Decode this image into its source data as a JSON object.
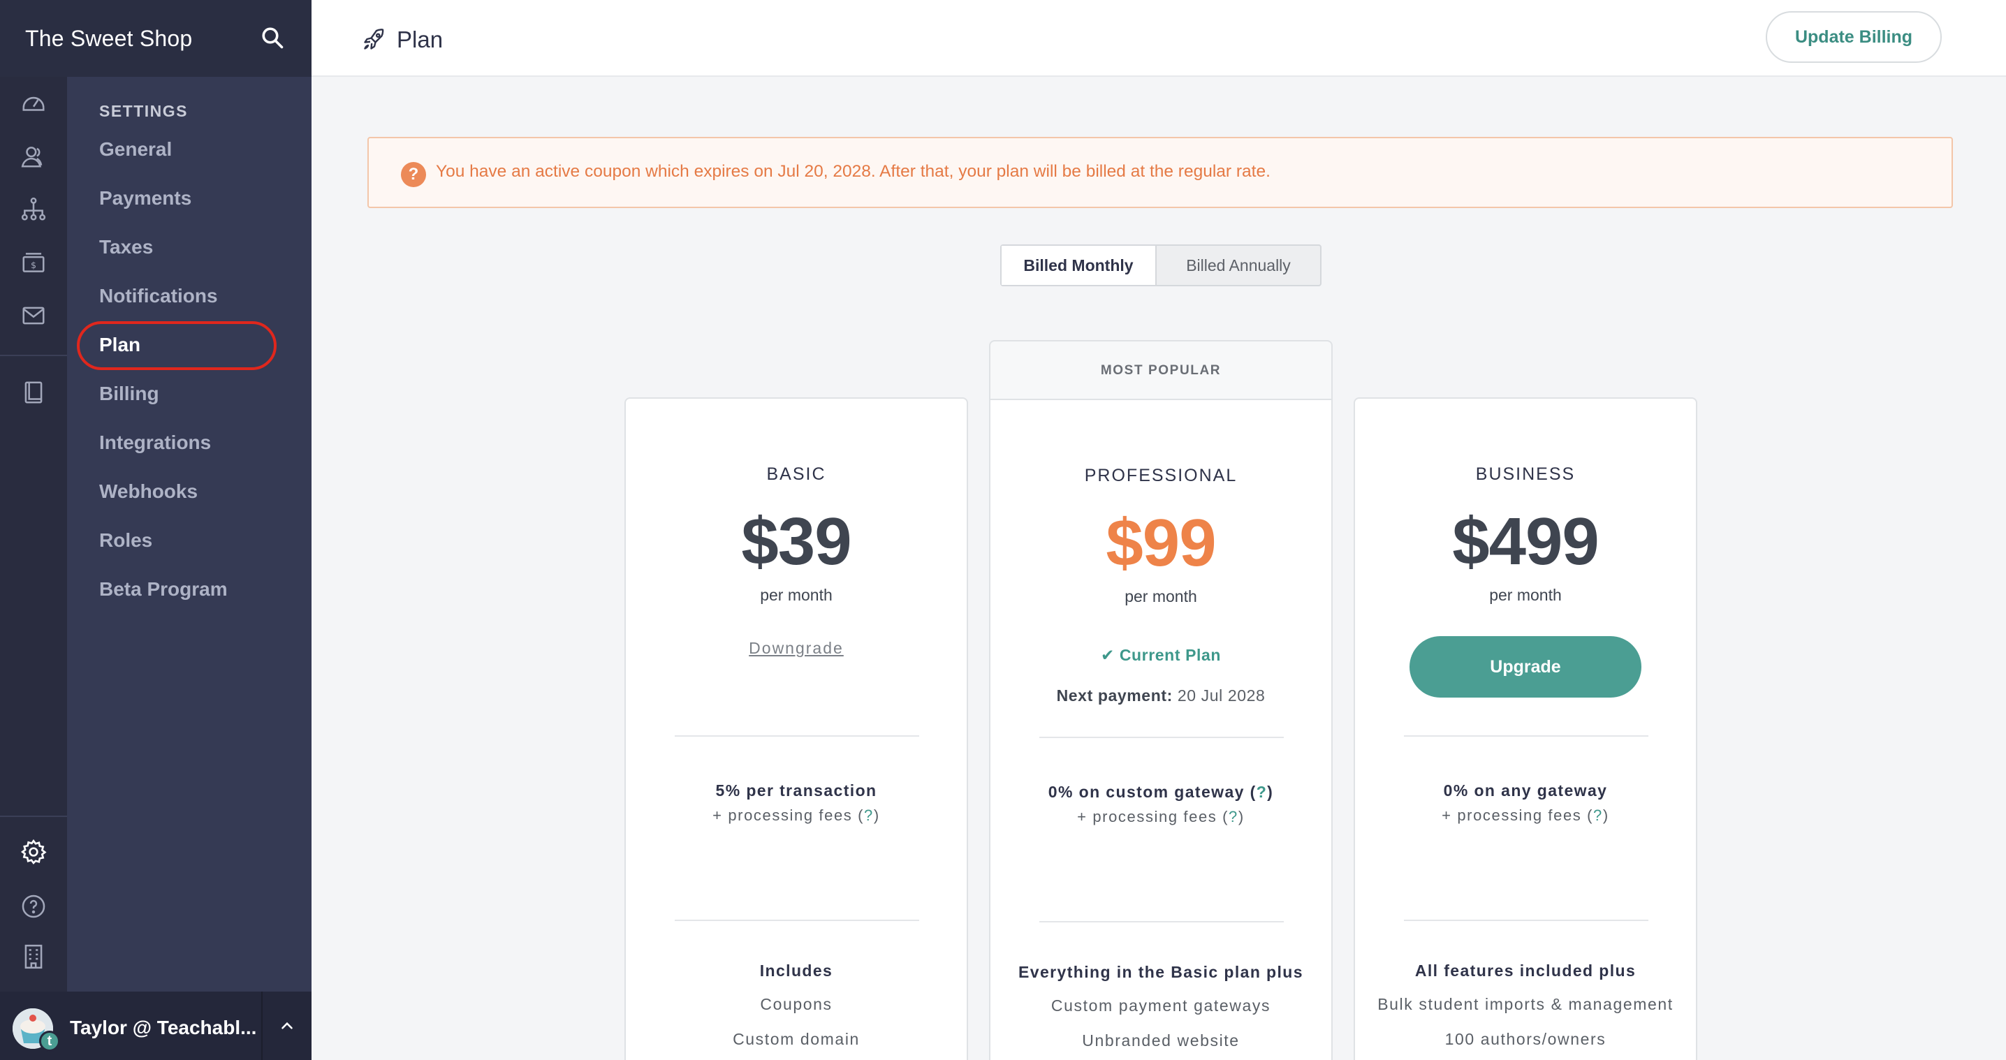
{
  "brand": {
    "title": "The Sweet Shop"
  },
  "icons": {
    "search": "search-icon",
    "dashboard": "dashboard-icon",
    "users": "users-icon",
    "sitemap": "sitemap-icon",
    "sales": "sales-icon",
    "email": "email-icon",
    "book": "book-icon",
    "settings": "gear-icon",
    "help": "help-icon",
    "building": "building-icon",
    "rocket": "rocket-icon",
    "chevron": "chevron-up-icon"
  },
  "settings": {
    "heading": "SETTINGS",
    "items": [
      {
        "label": "General"
      },
      {
        "label": "Payments"
      },
      {
        "label": "Taxes"
      },
      {
        "label": "Notifications"
      },
      {
        "label": "Plan",
        "active": true
      },
      {
        "label": "Billing"
      },
      {
        "label": "Integrations"
      },
      {
        "label": "Webhooks"
      },
      {
        "label": "Roles"
      },
      {
        "label": "Beta Program"
      }
    ]
  },
  "user": {
    "name": "Taylor @ Teachabl...",
    "badge": "t"
  },
  "header": {
    "title": "Plan",
    "update_billing": "Update Billing"
  },
  "coupon": {
    "icon": "?",
    "text": "You have an active coupon which expires on Jul 20, 2028. After that, your plan will be billed at the regular rate."
  },
  "billing_toggle": {
    "monthly": "Billed Monthly",
    "annually": "Billed Annually",
    "selected": "monthly"
  },
  "most_popular": "MOST POPULAR",
  "plans": [
    {
      "name": "BASIC",
      "price": "$39",
      "period": "per month",
      "action": "Downgrade",
      "fee": "5% per transaction",
      "fee_sub_prefix": "+ processing fees (",
      "fee_sub_q": "?",
      "fee_sub_suffix": ")",
      "includes_title": "Includes",
      "includes": [
        "Coupons",
        "Custom domain"
      ]
    },
    {
      "name": "PROFESSIONAL",
      "price": "$99",
      "period": "per month",
      "current": "Current Plan",
      "next_label": "Next payment:",
      "next_date": "20 Jul 2028",
      "fee_prefix": "0% on custom gateway (",
      "fee_q": "?",
      "fee_suffix": ")",
      "fee_sub_prefix": "+ processing fees (",
      "fee_sub_q": "?",
      "fee_sub_suffix": ")",
      "includes_title": "Everything in the Basic plan plus",
      "includes": [
        "Custom payment gateways",
        "Unbranded website"
      ]
    },
    {
      "name": "BUSINESS",
      "price": "$499",
      "period": "per month",
      "action": "Upgrade",
      "fee": "0% on any gateway",
      "fee_sub_prefix": "+ processing fees (",
      "fee_sub_q": "?",
      "fee_sub_suffix": ")",
      "includes_title": "All features included plus",
      "includes": [
        "Bulk student imports & management",
        "100 authors/owners"
      ]
    }
  ],
  "colors": {
    "accent": "#4b9e93",
    "price_highlight": "#ee8349",
    "sidebar": "#2f3349",
    "alert_text": "#e57a45",
    "highlight_ring": "#e0271d"
  }
}
